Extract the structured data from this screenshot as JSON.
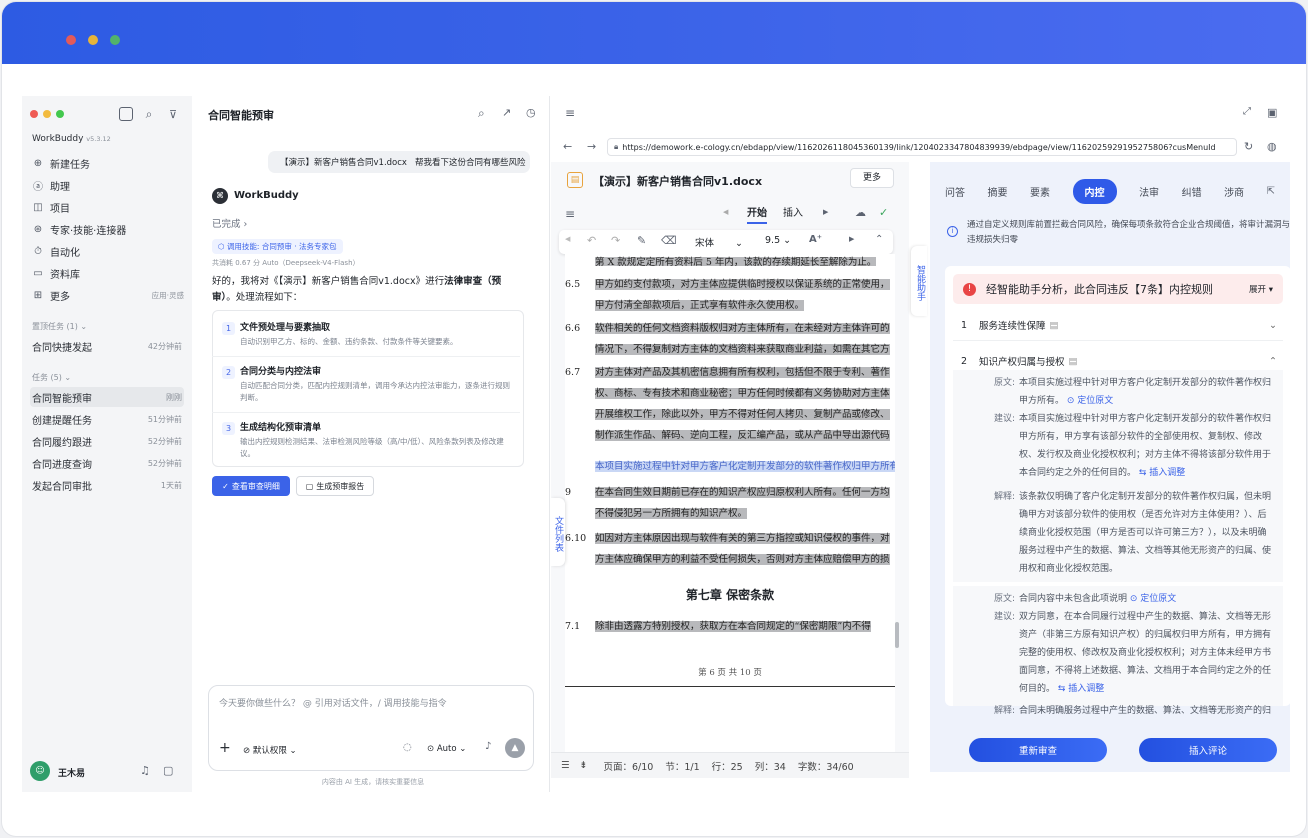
{
  "sidebar": {
    "app_name": "WorkBuddy",
    "version": "v5.3.12",
    "nav": [
      {
        "label": "新建任务",
        "icon": "new-task-icon"
      },
      {
        "label": "助理",
        "icon": "assistant-icon"
      },
      {
        "label": "项目",
        "icon": "project-icon"
      },
      {
        "label": "专家·技能·连接器",
        "icon": "expert-icon"
      },
      {
        "label": "自动化",
        "icon": "automation-icon"
      },
      {
        "label": "资料库",
        "icon": "library-icon"
      },
      {
        "label": "更多",
        "icon": "more-icon",
        "extra": "应用·灵感"
      }
    ],
    "pinned_label": "置顶任务 (1)",
    "pinned": [
      {
        "label": "合同快捷发起",
        "time": "42分钟前"
      }
    ],
    "tasks_label": "任务 (5)",
    "tasks": [
      {
        "label": "合同智能预审",
        "time": "刚刚"
      },
      {
        "label": "创建提醒任务",
        "time": "51分钟前"
      },
      {
        "label": "合同履约跟进",
        "time": "52分钟前"
      },
      {
        "label": "合同进度查询",
        "time": "52分钟前"
      },
      {
        "label": "发起合同审批",
        "time": "1天前"
      }
    ],
    "user": "王木易"
  },
  "chat": {
    "title": "合同智能预审",
    "user_file": "【演示】新客户销售合同v1.docx",
    "user_msg": "帮我看下这份合同有哪些风险",
    "bot_name": "WorkBuddy",
    "status": "已完成",
    "skill": "调用技能: 合同预审 · 法务专家包",
    "meta": "共消耗 0.67 分 Auto（Deepseek-V4-Flash）",
    "reply_prefix": "好的，我将对《【演示】新客户销售合同v1.docx》进行",
    "reply_bold": "法律审查（预审）",
    "reply_suffix": "。处理流程如下：",
    "steps": [
      {
        "n": "1",
        "title": "文件预处理与要素抽取",
        "desc": "自动识别甲乙方、标的、金额、违约条款、付款条件等关键要素。"
      },
      {
        "n": "2",
        "title": "合同分类与内控法审",
        "desc": "自动匹配合同分类，匹配内控规则清单，调用今承达内控法审能力，逐条进行规则判断。"
      },
      {
        "n": "3",
        "title": "生成结构化预审清单",
        "desc": "输出内控规则检测结果、法审检测风险等级（高/中/低）、风险条款列表及修改建议。"
      }
    ],
    "btn_view": "查看审查明细",
    "btn_report": "生成预审报告",
    "input_placeholder": "今天要你做些什么？ @ 引用对话文件，/ 调用技能与指令",
    "perm": "默认权限",
    "model": "Auto",
    "footer": "内容由 AI 生成，请核实重要信息"
  },
  "doc": {
    "url": "https://demowork.e-cology.cn/ebdapp/view/1162026118045360139/link/1204023347804839939/ebdpage/view/1162025929195275806?cusMenuId",
    "file": "【演示】新客户销售合同v1.docx",
    "more": "更多",
    "tabs": {
      "start": "开始",
      "insert": "插入"
    },
    "font": "宋体",
    "size": "9.5",
    "side_list": "文件列表",
    "side_assist": "智能助手",
    "paras": [
      {
        "num": "",
        "text": "第 X 款规定定所有资料后 5 年内，该款的存续期延长至解除为止。"
      },
      {
        "num": "6.5",
        "text": "甲方如约支付款项，对方主体应提供临时授权以保证系统的正常使用，甲方付清全部款项后，正式享有软件永久使用权。"
      },
      {
        "num": "6.6",
        "text": "软件相关的任何文档资料版权归对方主体所有，在未经对方主体许可的情况下，不得复制对方主体的文档资料来获取商业利益，如需在其它方面应用该类软件，必须经对方主体同意。"
      },
      {
        "num": "6.7",
        "text": "对方主体对产品及其机密信息拥有所有权利，包括但不限于专利、著作权、商标、专有技术和商业秘密；甲方任何时候都有义务协助对方主体开展维权工作，除此以外，甲方不得对任何人拷贝、复制产品或修改、制作派生作品、解码、逆向工程，反汇编产品，或从产品中导出源代码或目标代码，都将被视为严重侵权行为，由此给对方主体造成的损失由甲方承担。"
      },
      {
        "num": "",
        "text": "本项目实施过程中针对甲方客户化定制开发部分的软件著作权归甲方所有。"
      },
      {
        "num": "9",
        "text": "在本合同生效日期前已存在的知识产权应归原权利人所有。任何一方均不得侵犯另一方所拥有的知识产权。"
      },
      {
        "num": "6.10",
        "text": "如因对方主体原因出现与软件有关的第三方指控或知识侵权的事件，对方主体应确保甲方的利益不受任何损失，否则对方主体应赔偿甲方的损失。"
      }
    ],
    "chapter": "第七章 保密条款",
    "para71_num": "7.1",
    "para71": "除非由透露方特别授权，获取方在本合同规定的“保密期限”内不得",
    "page_footer": "第 6 页 共 10 页",
    "status": {
      "page": "页面：6/10",
      "section": "节：1/1",
      "row": "行：25",
      "col": "列：34",
      "words": "字数：34/60"
    }
  },
  "review": {
    "tabs": [
      "问答",
      "摘要",
      "要素",
      "内控",
      "法审",
      "纠错",
      "涉商"
    ],
    "active_tab": "内控",
    "info": "通过自定义规则库前置拦截合同风险，确保每项条款符合企业合规阈值，将审计漏洞与违规损失归零",
    "alert": "经智能助手分析，此合同违反【7条】内控规则",
    "expand": "展开",
    "items": [
      {
        "n": "1",
        "title": "服务连续性保障"
      },
      {
        "n": "2",
        "title": "知识产权归属与授权"
      }
    ],
    "labels": {
      "orig": "原文:",
      "sugg": "建议:",
      "expl": "解释:"
    },
    "blk1_orig": "本项目实施过程中针对甲方客户化定制开发部分的软件著作权归甲方所有。",
    "locate": "定位原文",
    "blk1_sugg": "本项目实施过程中针对甲方客户化定制开发部分的软件著作权归甲方所有，甲方享有该部分软件的全部使用权、复制权、修改权、发行权及商业化授权权利；对方主体不得将该部分软件用于本合同约定之外的任何目的。",
    "insert_adj": "插入调整",
    "blk1_expl": "该条款仅明确了客户化定制开发部分的软件著作权归属，但未明确甲方对该部分软件的使用权（是否允许对方主体使用？）、后续商业化授权范围（甲方是否可以许可第三方？），以及未明确服务过程中产生的数据、算法、文档等其他无形资产的归属、使用权和商业化授权范围。",
    "blk2_orig": "合同内容中未包含此项说明",
    "blk2_sugg": "双方同意，在本合同履行过程中产生的数据、算法、文档等无形资产（非第三方原有知识产权）的归属权归甲方所有，甲方拥有完整的使用权、修改权及商业化授权权利；对方主体未经甲方书面同意，不得将上述数据、算法、文档用于本合同约定之外的任何目的。",
    "blk2_expl": "合同未明确服务过程中产生的数据、算法、文档等无形资产的归属权、使用权及后续商业化授权范围，存在潜在权属纠纷风险。",
    "btn_rereview": "重新审查",
    "btn_comment": "插入评论"
  }
}
